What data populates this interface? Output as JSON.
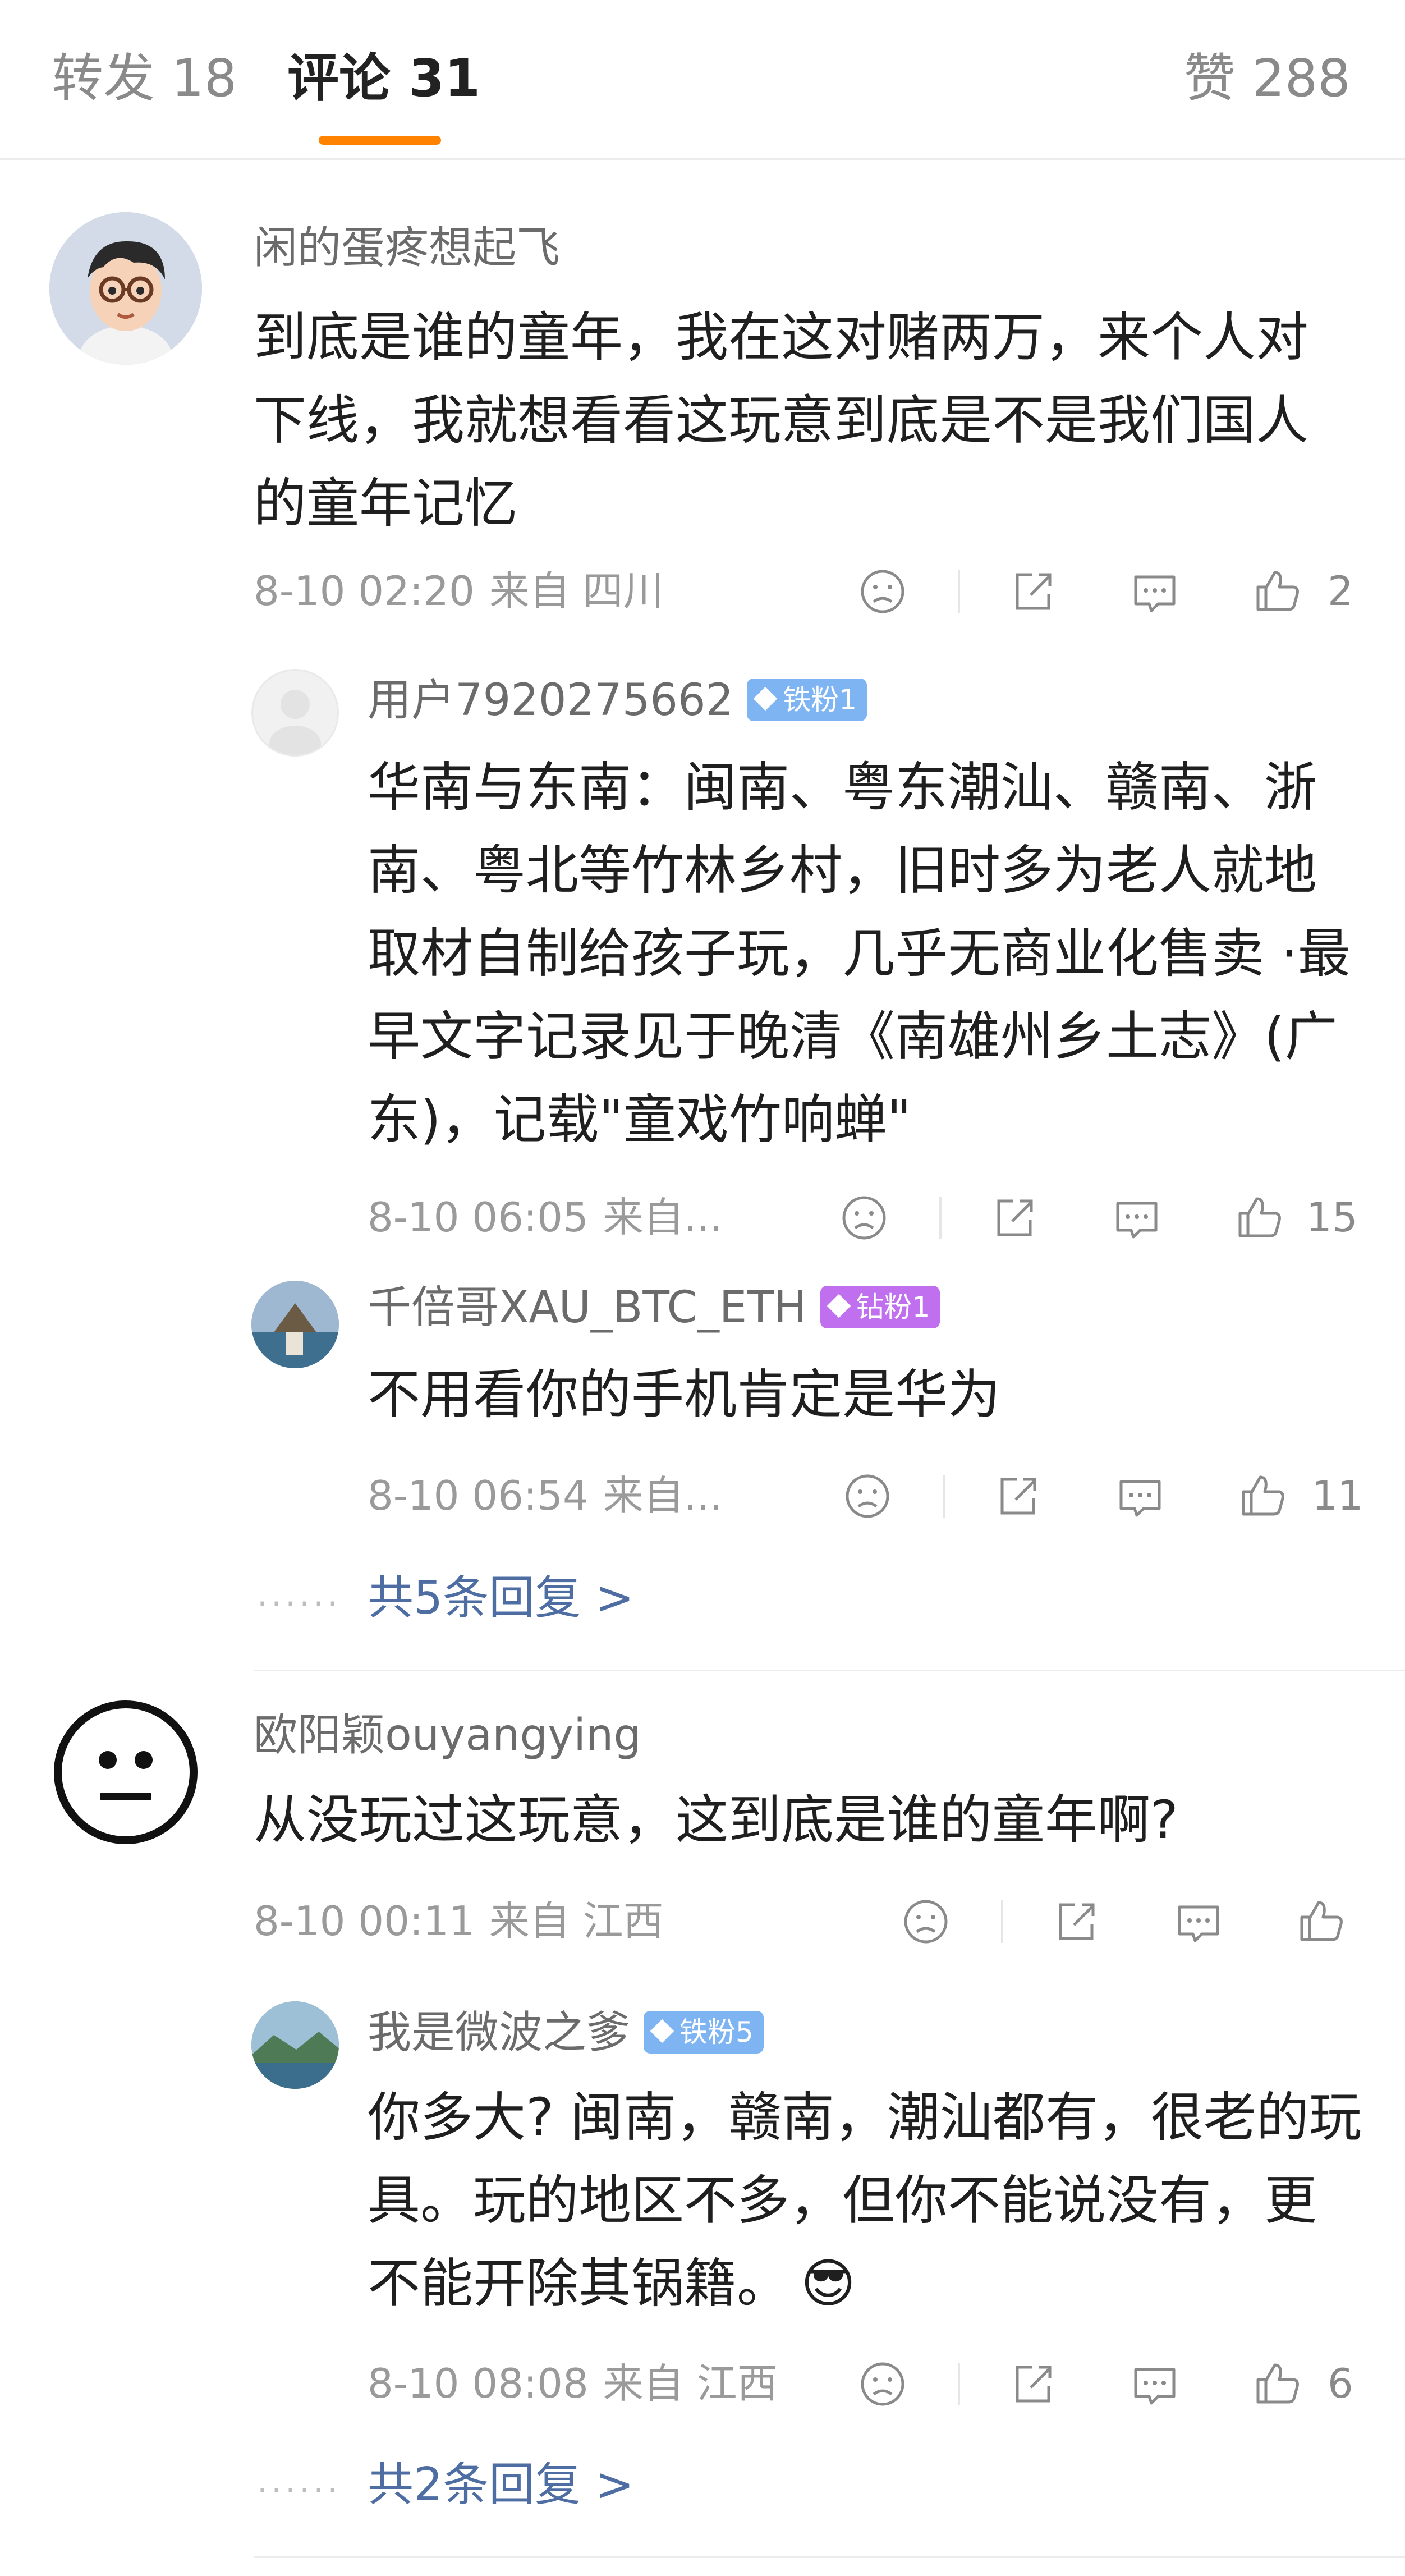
{
  "tabs": {
    "repost": "转发 18",
    "comments": "评论 31",
    "likes": "赞 288"
  },
  "comments": [
    {
      "username": "闲的蛋疼想起飞",
      "text": "到底是谁的童年，我在这对赌两万，来个人对下线，我就想看看这玩意到底是不是我们国人的童年记忆",
      "time": "8-10 02:20",
      "location": "来自 四川",
      "likes": "2",
      "replies": [
        {
          "username": "用户7920275662",
          "badge": "铁粉1",
          "text": "华南与东南：闽南、粤东潮汕、赣南、浙南、粤北等竹林乡村，旧时多为老人就地取材自制给孩子玩，几乎无商业化售卖 ·最早文字记录见于晚清《南雄州乡土志》(广东)，记载\"童戏竹响蝉\"",
          "time": "8-10 06:05",
          "location": "来自...",
          "likes": "15"
        },
        {
          "username": "千倍哥XAU_BTC_ETH",
          "badge": "钻粉1",
          "text": "不用看你的手机肯定是华为",
          "time": "8-10 06:54",
          "location": "来自...",
          "likes": "11"
        }
      ],
      "more_replies": "共5条回复 >"
    },
    {
      "username": "欧阳颖ouyangying",
      "text": "从没玩过这玩意，这到底是谁的童年啊?",
      "time": "8-10 00:11",
      "location": "来自 江西",
      "likes": "",
      "replies": [
        {
          "username": "我是微波之爹",
          "badge": "铁粉5",
          "text": "你多大? 闽南，赣南，潮汕都有，很老的玩具。玩的地区不多，但你不能说没有，更不能开除其锅籍。",
          "emoji": "😎",
          "time": "8-10 08:08",
          "location": "来自 江西",
          "likes": "6"
        }
      ],
      "more_replies": "共2条回复 >"
    }
  ],
  "dots": "......",
  "colors": {
    "accent": "#ff8200",
    "link": "#4e6ea3",
    "meta": "#9a9a9a",
    "iron_badge": "#7eb4f2",
    "diamond_badge": "#c070ee"
  },
  "icons": [
    "sad-face-icon",
    "share-icon",
    "comment-icon",
    "thumbs-up-icon"
  ]
}
